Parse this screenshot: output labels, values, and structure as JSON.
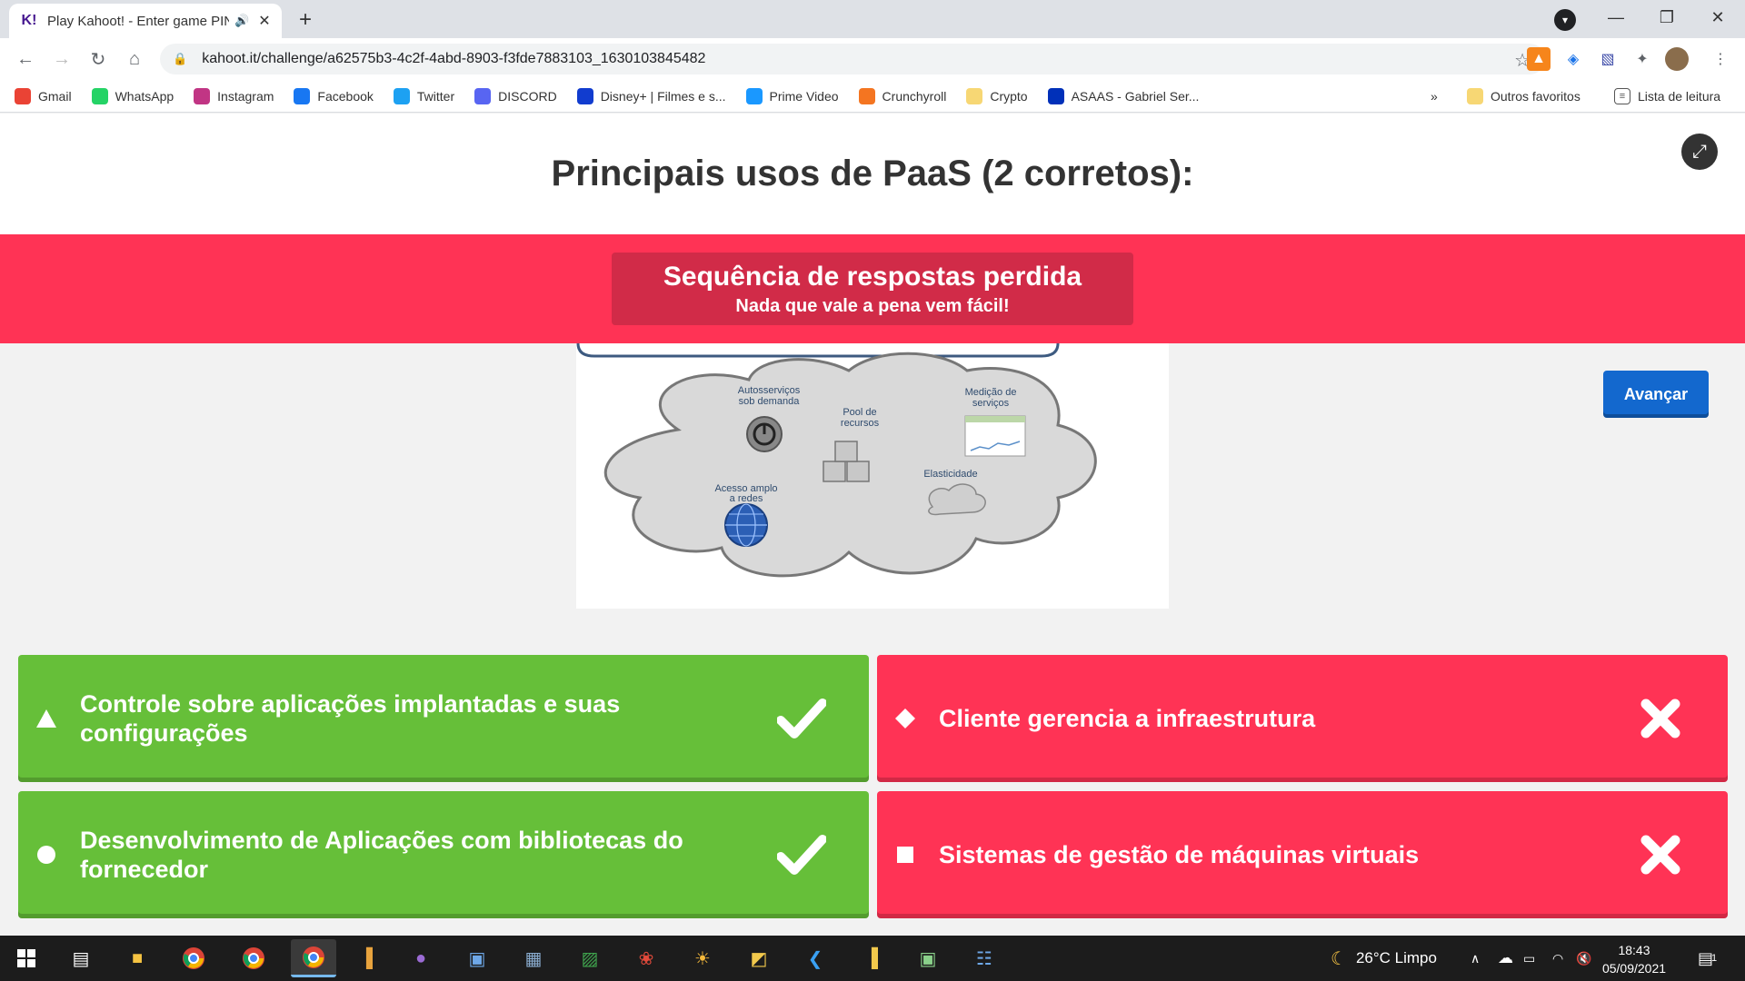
{
  "browser": {
    "tab_title": "Play Kahoot! - Enter game PIN",
    "url": "kahoot.it/challenge/a62575b3-4c2f-4abd-8903-f3fde7883103_1630103845482",
    "bookmarks": [
      {
        "label": "Gmail",
        "icon": "gmail-icon",
        "color": "#ea4335"
      },
      {
        "label": "WhatsApp",
        "icon": "whatsapp-icon",
        "color": "#25d366"
      },
      {
        "label": "Instagram",
        "icon": "instagram-icon",
        "color": "#c13584"
      },
      {
        "label": "Facebook",
        "icon": "facebook-icon",
        "color": "#1877f2"
      },
      {
        "label": "Twitter",
        "icon": "twitter-icon",
        "color": "#1da1f2"
      },
      {
        "label": "DISCORD",
        "icon": "discord-icon",
        "color": "#5865f2"
      },
      {
        "label": "Disney+ | Filmes e s...",
        "icon": "disney-icon",
        "color": "#113ccf"
      },
      {
        "label": "Prime Video",
        "icon": "primevideo-icon",
        "color": "#1a98ff"
      },
      {
        "label": "Crunchyroll",
        "icon": "crunchyroll-icon",
        "color": "#f47521"
      },
      {
        "label": "Crypto",
        "icon": "folder-icon",
        "color": "#f7d774"
      },
      {
        "label": "ASAAS - Gabriel Ser...",
        "icon": "asaas-icon",
        "color": "#0030b9"
      }
    ],
    "bookmarks_overflow": "»",
    "other_bookmarks": "Outros favoritos",
    "reading_list": "Lista de leitura"
  },
  "quiz": {
    "question": "Principais usos de PaaS (2 corretos):",
    "streak_title": "Sequência de respostas perdida",
    "streak_subtitle": "Nada que vale a pena vem fácil!",
    "next_button": "Avançar",
    "image_labels": {
      "autosservicos": [
        "Autosserviços",
        "sob demanda"
      ],
      "pool": [
        "Pool de",
        "recursos"
      ],
      "medicao": [
        "Medição de",
        "serviços"
      ],
      "elasticidade": [
        "Elasticidade"
      ],
      "acesso": [
        "Acesso amplo",
        "a redes"
      ]
    },
    "answers": [
      {
        "shape": "triangle",
        "text": "Controle sobre aplicações implantadas e suas configurações",
        "correct": true,
        "color": "#66bf39"
      },
      {
        "shape": "diamond",
        "text": "Cliente gerencia a infraestrutura",
        "correct": false,
        "color": "#ff3355"
      },
      {
        "shape": "circle",
        "text": "Desenvolvimento de Aplicações com bibliotecas do fornecedor",
        "correct": true,
        "color": "#66bf39"
      },
      {
        "shape": "square",
        "text": "Sistemas de gestão de máquinas virtuais",
        "correct": false,
        "color": "#ff3355"
      }
    ]
  },
  "taskbar": {
    "weather": "26°C  Limpo",
    "time": "18:43",
    "date": "05/09/2021",
    "notifications": "1"
  }
}
